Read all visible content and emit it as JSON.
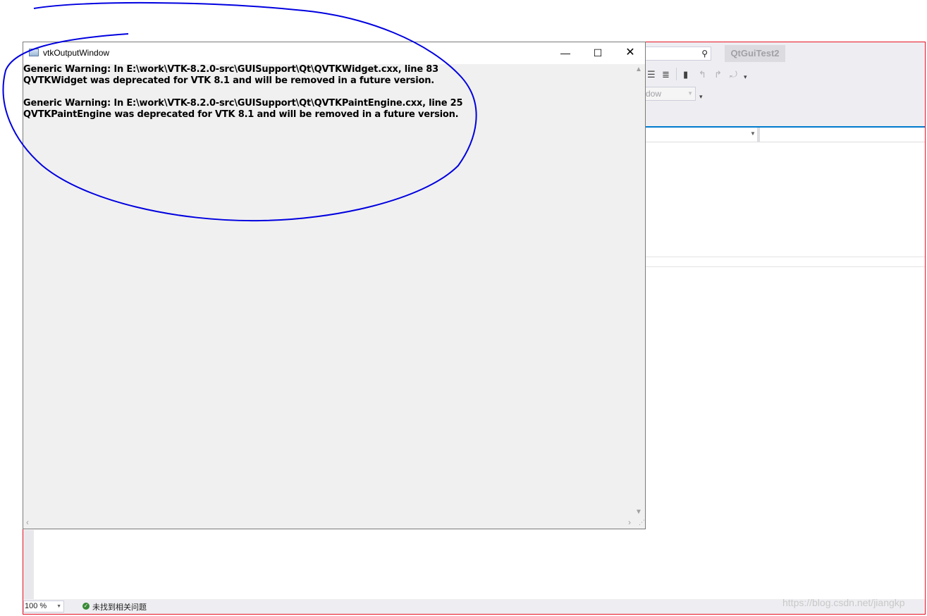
{
  "ide": {
    "project_name": "QtGuiTest2",
    "config_combo": "dow",
    "zoom": "100 %",
    "issues_status": "未找到相关问题"
  },
  "vtk_window": {
    "title": "vtkOutputWindow",
    "messages": [
      {
        "line1": "Generic Warning: In E:\\work\\VTK-8.2.0-src\\GUISupport\\Qt\\QVTKWidget.cxx, line 83",
        "line2": "QVTKWidget was deprecated for VTK 8.1 and will be removed in a future version."
      },
      {
        "line1": "Generic Warning: In E:\\work\\VTK-8.2.0-src\\GUISupport\\Qt\\QVTKPaintEngine.cxx, line 25",
        "line2": "QVTKPaintEngine was deprecated for VTK 8.1 and will be removed in a future version."
      }
    ]
  },
  "watermark": "https://blog.csdn.net/jiangkp",
  "colors": {
    "annotation": "#0000e0",
    "ide_frame": "#e81123",
    "ide_accent": "#007acc"
  }
}
